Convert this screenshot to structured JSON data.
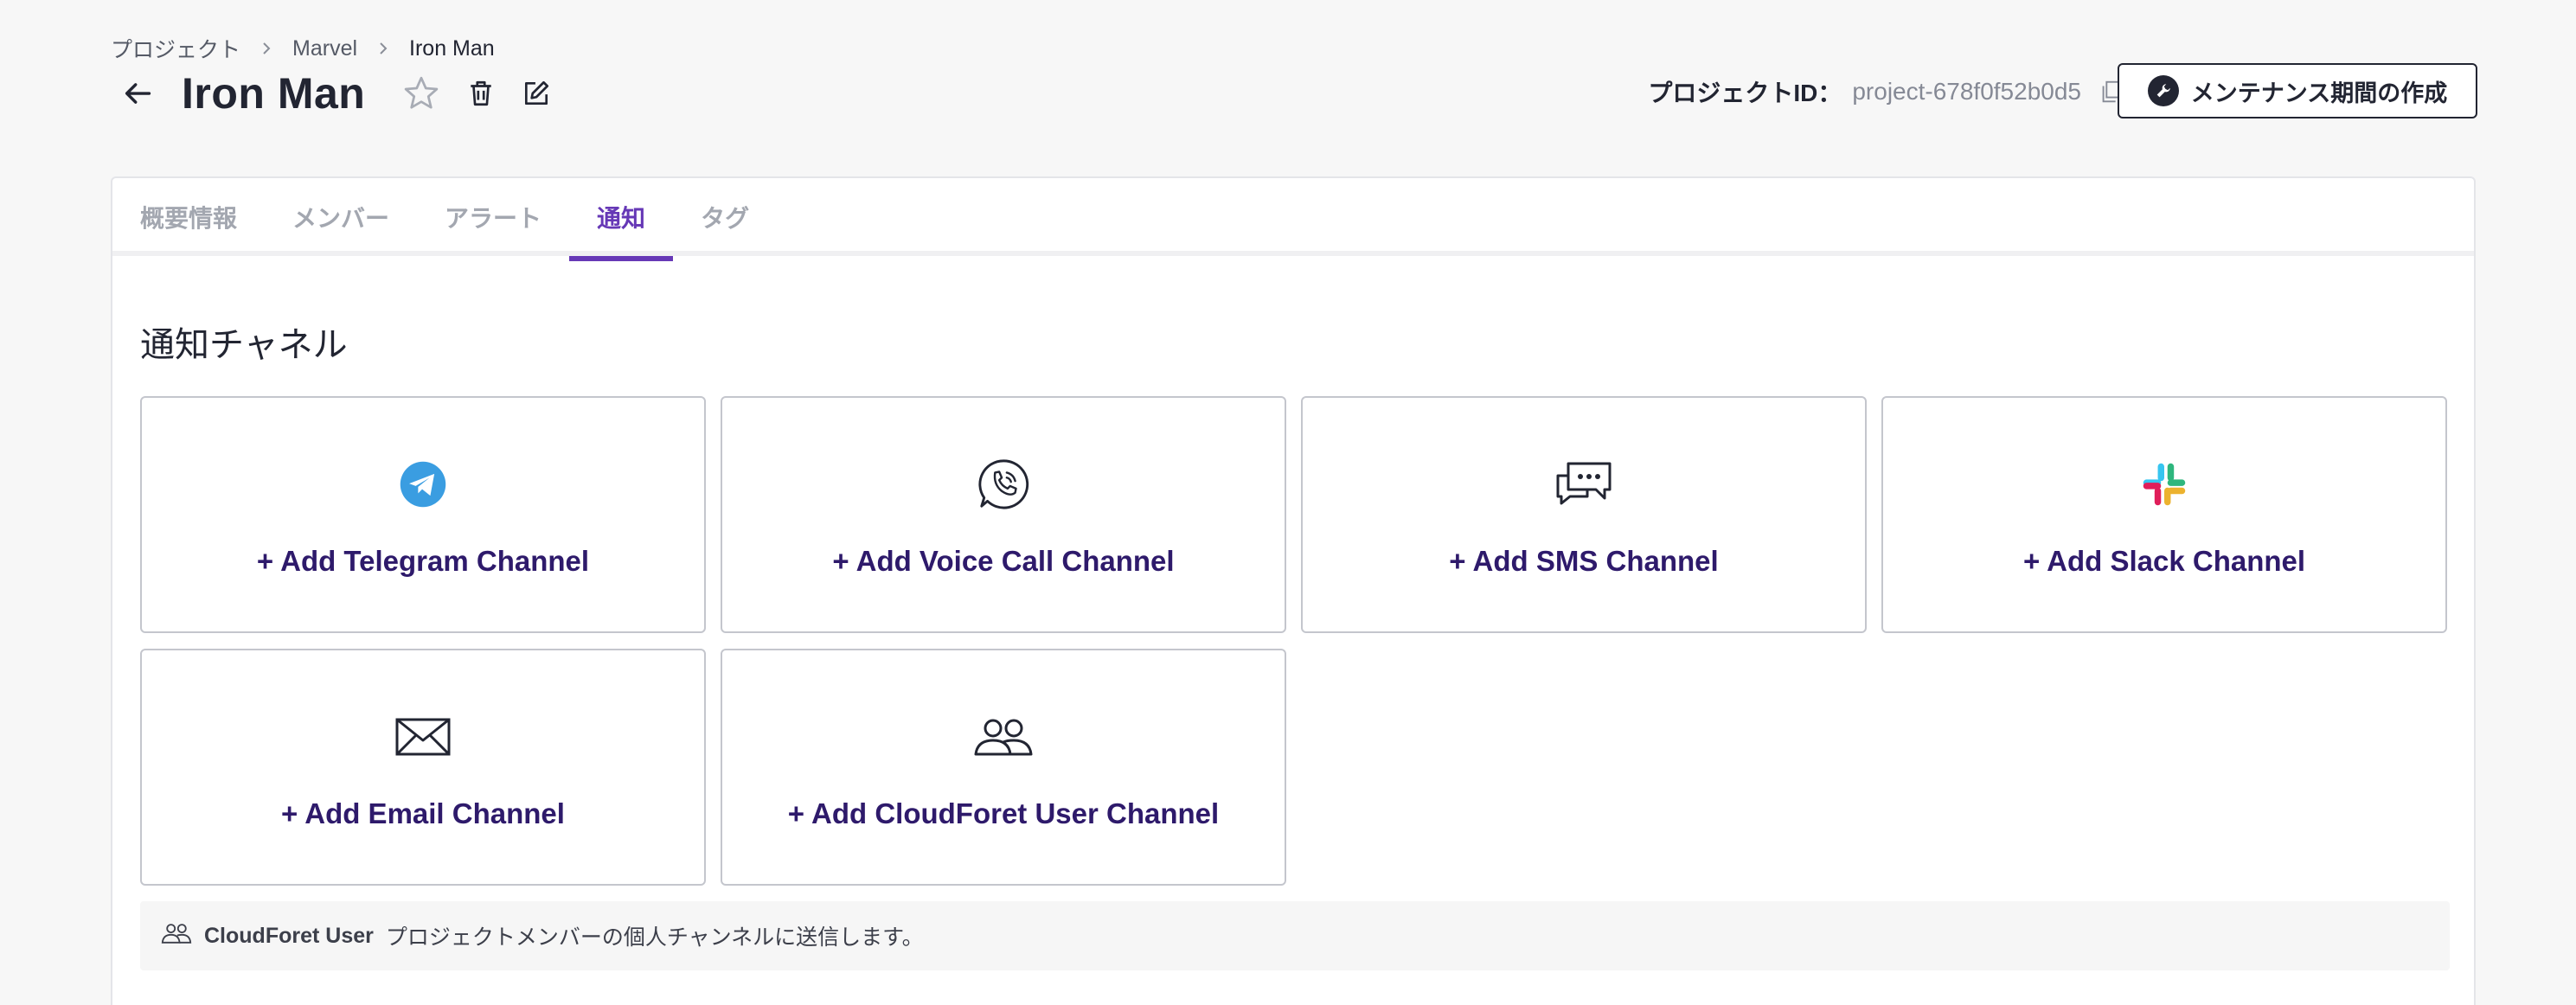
{
  "breadcrumb": {
    "root": "プロジェクト",
    "group": "Marvel",
    "current": "Iron Man"
  },
  "header": {
    "title": "Iron Man",
    "project_id_label": "プロジェクトID：",
    "project_id_value": "project-678f0f52b0d5",
    "maintenance_button": "メンテナンス期間の作成"
  },
  "tabs": [
    {
      "label": "概要情報",
      "active": false
    },
    {
      "label": "メンバー",
      "active": false
    },
    {
      "label": "アラート",
      "active": false
    },
    {
      "label": "通知",
      "active": true
    },
    {
      "label": "タグ",
      "active": false
    }
  ],
  "section": {
    "title": "通知チャネル"
  },
  "channels": [
    {
      "label": "+ Add Telegram Channel",
      "icon": "telegram-icon"
    },
    {
      "label": "+ Add Voice Call Channel",
      "icon": "phone-call-icon"
    },
    {
      "label": "+ Add SMS Channel",
      "icon": "chat-bubbles-icon"
    },
    {
      "label": "+ Add Slack Channel",
      "icon": "slack-icon"
    },
    {
      "label": "+ Add Email Channel",
      "icon": "envelope-icon"
    },
    {
      "label": "+ Add CloudForet User Channel",
      "icon": "users-icon"
    }
  ],
  "info": {
    "bold": "CloudForet User",
    "text": "プロジェクトメンバーの個人チャンネルに送信します。"
  },
  "colors": {
    "accent": "#6638b6",
    "channel_label": "#2e1a6b",
    "telegram": "#3a9de1"
  }
}
